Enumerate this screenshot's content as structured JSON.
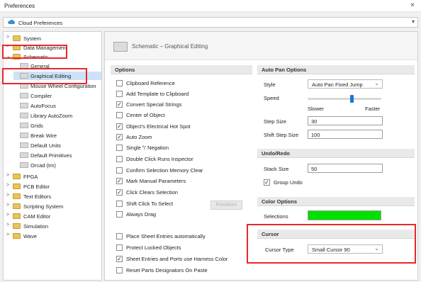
{
  "window": {
    "title": "Preferences",
    "close_glyph": "×"
  },
  "cloud_combo": {
    "label": "Cloud Preferences",
    "icon": "cloud-icon",
    "caret": "▾"
  },
  "tree": {
    "items": [
      {
        "label": "System",
        "arrow": ">",
        "type": "folder"
      },
      {
        "label": "Data Management",
        "arrow": ">",
        "type": "folder"
      },
      {
        "label": "Schematic",
        "arrow": "⌄",
        "type": "folder"
      },
      {
        "label": "General",
        "arrow": "",
        "type": "page"
      },
      {
        "label": "Graphical Editing",
        "arrow": "",
        "type": "page"
      },
      {
        "label": "Mouse Wheel Configuration",
        "arrow": "",
        "type": "page"
      },
      {
        "label": "Compiler",
        "arrow": "",
        "type": "page"
      },
      {
        "label": "AutoFocus",
        "arrow": "",
        "type": "page"
      },
      {
        "label": "Library AutoZoom",
        "arrow": "",
        "type": "page"
      },
      {
        "label": "Grids",
        "arrow": "",
        "type": "page"
      },
      {
        "label": "Break Wire",
        "arrow": "",
        "type": "page"
      },
      {
        "label": "Default Units",
        "arrow": "",
        "type": "page"
      },
      {
        "label": "Default Primitives",
        "arrow": "",
        "type": "page"
      },
      {
        "label": "Orcad (tm)",
        "arrow": "",
        "type": "page"
      },
      {
        "label": "FPGA",
        "arrow": ">",
        "type": "folder"
      },
      {
        "label": "PCB Editor",
        "arrow": ">",
        "type": "folder"
      },
      {
        "label": "Text Editors",
        "arrow": ">",
        "type": "folder"
      },
      {
        "label": "Scripting System",
        "arrow": ">",
        "type": "folder"
      },
      {
        "label": "CAM Editor",
        "arrow": ">",
        "type": "folder"
      },
      {
        "label": "Simulation",
        "arrow": ">",
        "type": "folder"
      },
      {
        "label": "Wave",
        "arrow": ">",
        "type": "folder"
      }
    ],
    "selected_index": 4
  },
  "page": {
    "title": "Schematic – Graphical Editing"
  },
  "options": {
    "header": "Options",
    "items": [
      {
        "label": "Clipboard Reference",
        "checked": false
      },
      {
        "label": "Add Template to Clipboard",
        "checked": false
      },
      {
        "label": "Convert Special Strings",
        "checked": true
      },
      {
        "label": "Center of Object",
        "checked": false
      },
      {
        "label": "Object's Electrical Hot Spot",
        "checked": true
      },
      {
        "label": "Auto Zoom",
        "checked": true
      },
      {
        "label": "Single '\\' Negation",
        "checked": false
      },
      {
        "label": "Double Click Runs Inspector",
        "checked": false
      },
      {
        "label": "Confirm Selection Memory Clear",
        "checked": false
      },
      {
        "label": "Mark Manual Parameters",
        "checked": true
      },
      {
        "label": "Click Clears Selection",
        "checked": true
      },
      {
        "label": "Shift Click To Select",
        "checked": false
      },
      {
        "label": "Always Drag",
        "checked": false
      }
    ],
    "primitives_button": "Primitives",
    "bottom_items": [
      {
        "label": "Place Sheet Entries automatically",
        "checked": false
      },
      {
        "label": "Protect Locked Objects",
        "checked": false
      },
      {
        "label": "Sheet Entries and Ports use Harness Color",
        "checked": true
      },
      {
        "label": "Reset Parts Designators On Paste",
        "checked": false
      }
    ]
  },
  "auto_pan": {
    "header": "Auto Pan Options",
    "style_label": "Style",
    "style_value": "Auto Pan Fixed Jump",
    "speed_label": "Speed",
    "speed_fraction": 0.6,
    "slower": "Slower",
    "faster": "Faster",
    "step_size_label": "Step Size",
    "step_size_value": "30",
    "shift_step_label": "Shift Step Size",
    "shift_step_value": "100"
  },
  "undo": {
    "header": "Undo/Redo",
    "stack_label": "Stack Size",
    "stack_value": "50",
    "group_undo_label": "Group Undo",
    "group_undo_checked": true
  },
  "color_options": {
    "header": "Color Options",
    "selections_label": "Selections",
    "selections_color": "#00e000"
  },
  "cursor": {
    "header": "Cursor",
    "type_label": "Cursor Type",
    "type_value": "Small Cursor 90"
  },
  "dropdown_glyph": "⌄",
  "check_glyph": "✓",
  "highlight_color": "#e8282a"
}
